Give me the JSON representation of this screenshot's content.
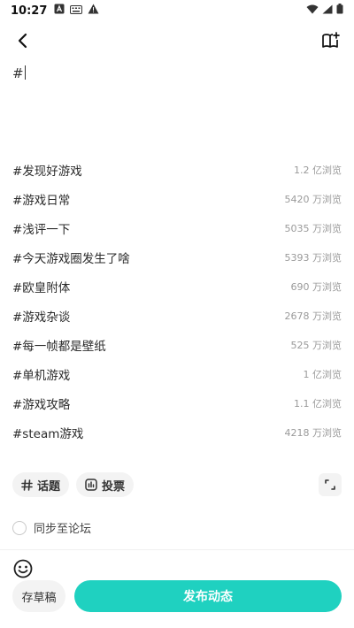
{
  "status_bar": {
    "time": "10:27",
    "left_icons": [
      "a-icon",
      "keyboard-icon",
      "warning-icon"
    ],
    "right_icons": [
      "wifi-icon",
      "signal-icon",
      "battery-icon"
    ]
  },
  "editor": {
    "text": "#"
  },
  "topics": [
    {
      "name": "#发现好游戏",
      "views": "1.2 亿浏览"
    },
    {
      "name": "#游戏日常",
      "views": "5420 万浏览"
    },
    {
      "name": "#浅评一下",
      "views": "5035 万浏览"
    },
    {
      "name": "#今天游戏圈发生了啥",
      "views": "5393 万浏览"
    },
    {
      "name": "#欧皇附体",
      "views": "690 万浏览"
    },
    {
      "name": "#游戏杂谈",
      "views": "2678 万浏览"
    },
    {
      "name": "#每一帧都是壁纸",
      "views": "525 万浏览"
    },
    {
      "name": "#单机游戏",
      "views": "1 亿浏览"
    },
    {
      "name": "#游戏攻略",
      "views": "1.1 亿浏览"
    },
    {
      "name": "#steam游戏",
      "views": "4218 万浏览"
    }
  ],
  "tools": {
    "topic_label": "话题",
    "vote_label": "投票"
  },
  "sync": {
    "label": "同步至论坛"
  },
  "bottom": {
    "draft_label": "存草稿",
    "publish_label": "发布动态"
  },
  "colors": {
    "accent": "#1fd1c0"
  }
}
